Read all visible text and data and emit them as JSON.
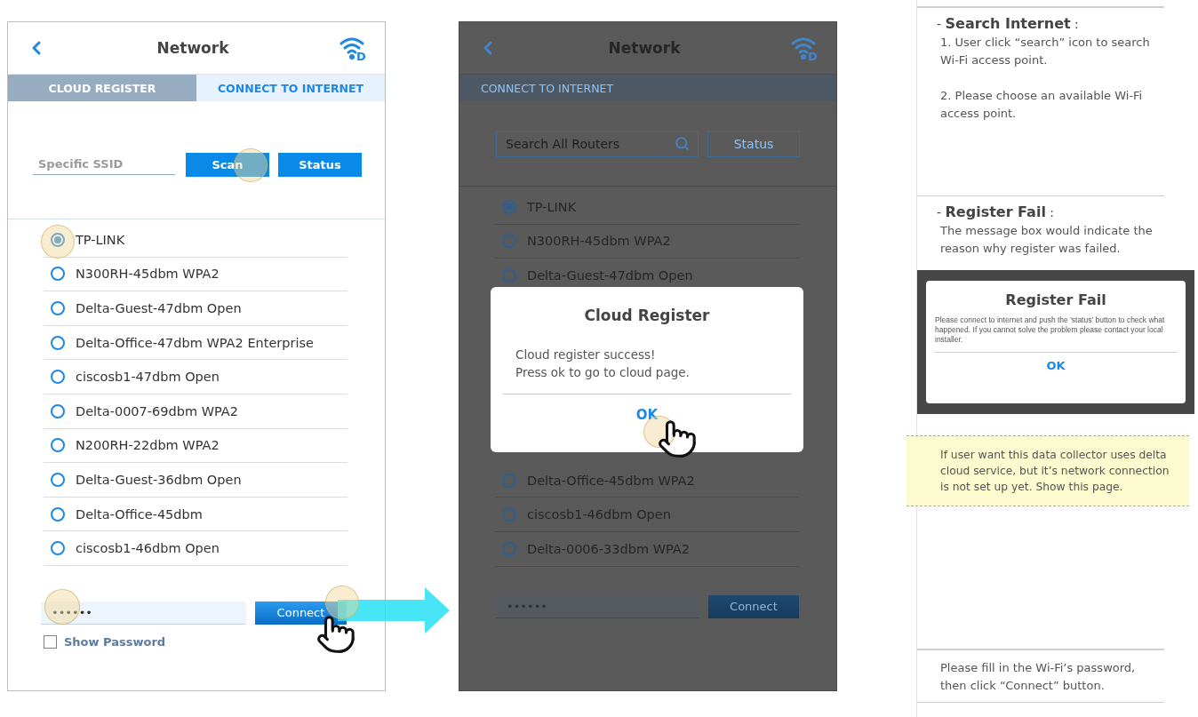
{
  "left_screen": {
    "header": {
      "title": "Network",
      "badge_letter": "D"
    },
    "tabs": [
      {
        "label": "CLOUD REGISTER",
        "selected": false
      },
      {
        "label": "CONNECT TO INTERNET",
        "selected": true
      }
    ],
    "ssid_field": {
      "placeholder": "Specific SSID"
    },
    "buttons": [
      "Scan",
      "Status"
    ],
    "networks": [
      {
        "name": "TP-LINK",
        "selected": true
      },
      {
        "name": "N300RH-45dbm WPA2",
        "selected": false
      },
      {
        "name": "Delta-Guest-47dbm Open",
        "selected": false
      },
      {
        "name": "Delta-Office-47dbm WPA2 Enterprise",
        "selected": false
      },
      {
        "name": "ciscosb1-47dbm Open",
        "selected": false
      },
      {
        "name": "Delta-0007-69dbm WPA2",
        "selected": false
      },
      {
        "name": "N200RH-22dbm WPA2",
        "selected": false
      },
      {
        "name": "Delta-Guest-36dbm Open",
        "selected": false
      },
      {
        "name": "Delta-Office-45dbm",
        "selected": false
      },
      {
        "name": "ciscosb1-46dbm Open",
        "selected": false
      }
    ],
    "password_field": {
      "value": "••••••"
    },
    "connect_button": "Connect",
    "show_password": {
      "label": "Show Password",
      "checked": false
    }
  },
  "middle_screen": {
    "header": {
      "title": "Network",
      "badge_letter": "D"
    },
    "tab_bar": {
      "label": "CONNECT TO INTERNET"
    },
    "search_field": {
      "placeholder": "Search All Routers"
    },
    "status_button": "Status",
    "networks_above_dialog": [
      {
        "name": "TP-LINK",
        "selected": true
      },
      {
        "name": "N300RH-45dbm WPA2",
        "selected": false
      },
      {
        "name": "Delta-Guest-47dbm Open",
        "selected": false
      }
    ],
    "networks_below_dialog": [
      {
        "name": "Delta-Office-45dbm WPA2",
        "selected": false
      },
      {
        "name": "ciscosb1-46dbm Open",
        "selected": false
      },
      {
        "name": "Delta-0006-33dbm WPA2",
        "selected": false
      }
    ],
    "password_field": {
      "value": "••••••"
    },
    "connect_button": "Connect",
    "dialog": {
      "title": "Cloud Register",
      "message": [
        "Cloud register success!",
        "Press ok to go to cloud page."
      ],
      "button": "OK"
    }
  },
  "notes": {
    "search_internet": {
      "heading": "- **Search Internet** :",
      "steps": [
        "1. User click “search” icon to search Wi-Fi access point.",
        "2. Please choose an available Wi-Fi access point."
      ]
    },
    "register_fail": {
      "heading": "- **Register Fail** :",
      "text": "The message box would indicate the reason why register was failed.",
      "dialog": {
        "title": "Register Fail",
        "message": "Please connect to internet and push the 'status' button to check what happened. If you cannot solve the problem please contact your local installer.",
        "button": "OK"
      },
      "highlight": "If user want this data collector uses delta cloud service, but it’s network connection is not set up yet. Show this page."
    },
    "password_hint": "Please fill in the Wi-Fi’s password, then click “Connect” button."
  }
}
